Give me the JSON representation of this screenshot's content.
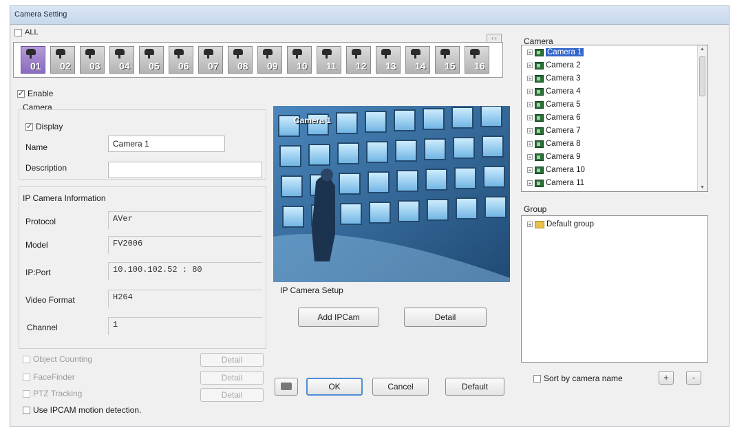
{
  "window": {
    "title": "Camera Setting"
  },
  "all_checkbox": {
    "label": "ALL",
    "checked": false
  },
  "thumbnails": [
    {
      "num": "01",
      "active": true
    },
    {
      "num": "02"
    },
    {
      "num": "03"
    },
    {
      "num": "04"
    },
    {
      "num": "05"
    },
    {
      "num": "06"
    },
    {
      "num": "07"
    },
    {
      "num": "08"
    },
    {
      "num": "09"
    },
    {
      "num": "10"
    },
    {
      "num": "11"
    },
    {
      "num": "12"
    },
    {
      "num": "13"
    },
    {
      "num": "14"
    },
    {
      "num": "15"
    },
    {
      "num": "16"
    }
  ],
  "nav_arrows": "‹ ›",
  "enable": {
    "label": "Enable",
    "checked": true
  },
  "camera_section": {
    "title": "Camera",
    "display_label": "Display",
    "display_checked": true,
    "name_label": "Name",
    "name_value": "Camera 1",
    "description_label": "Description",
    "description_value": ""
  },
  "ip_info": {
    "title": "IP Camera Information",
    "protocol_label": "Protocol",
    "protocol_value": "AVer",
    "model_label": "Model",
    "model_value": "FV2006",
    "ipport_label": "IP:Port",
    "ipport_value": "10.100.102.52 : 80",
    "video_format_label": "Video Format",
    "video_format_value": "H264",
    "channel_label": "Channel",
    "channel_value": "1"
  },
  "options": {
    "object_counting": "Object Counting",
    "facefinder": "FaceFinder",
    "ptz_tracking": "PTZ Tracking",
    "use_motion": "Use IPCAM motion detection.",
    "detail_label": "Detail"
  },
  "preview": {
    "overlay_label": "Camera 1"
  },
  "ip_setup": {
    "title": "IP Camera Setup",
    "add_label": "Add IPCam",
    "detail_label": "Detail"
  },
  "bottom_buttons": {
    "ok": "OK",
    "cancel": "Cancel",
    "default": "Default"
  },
  "camera_tree": {
    "title": "Camera",
    "items": [
      "Camera 1",
      "Camera 2",
      "Camera 3",
      "Camera 4",
      "Camera 5",
      "Camera 6",
      "Camera 7",
      "Camera 8",
      "Camera 9",
      "Camera 10",
      "Camera 11"
    ]
  },
  "group_tree": {
    "title": "Group",
    "items": [
      "Default group"
    ]
  },
  "sort_by_name": {
    "label": "Sort by camera name",
    "checked": false
  },
  "group_buttons": {
    "add": "+",
    "remove": "-"
  }
}
